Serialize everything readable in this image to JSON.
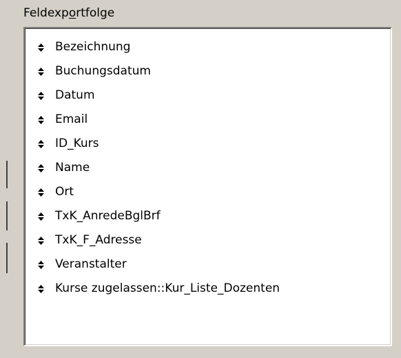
{
  "group": {
    "label_pre": "Feldexp",
    "label_accel": "o",
    "label_post": "rtfolge"
  },
  "fields": [
    {
      "label": "Bezeichnung",
      "icon": "move-handle-icon"
    },
    {
      "label": "Buchungsdatum",
      "icon": "move-handle-icon"
    },
    {
      "label": "Datum",
      "icon": "move-handle-icon"
    },
    {
      "label": "Email",
      "icon": "move-handle-icon"
    },
    {
      "label": "ID_Kurs",
      "icon": "move-handle-icon"
    },
    {
      "label": "Name",
      "icon": "move-handle-icon"
    },
    {
      "label": "Ort",
      "icon": "move-handle-icon"
    },
    {
      "label": "TxK_AnredeBglBrf",
      "icon": "move-handle-icon"
    },
    {
      "label": "TxK_F_Adresse",
      "icon": "move-handle-icon"
    },
    {
      "label": "Veranstalter",
      "icon": "move-handle-icon"
    },
    {
      "label": "Kurse zugelassen::Kur_Liste_Dozenten",
      "icon": "move-handle-icon"
    }
  ],
  "colors": {
    "window_background": "#d4d0c8",
    "list_background": "#ffffff",
    "text": "#000000"
  }
}
